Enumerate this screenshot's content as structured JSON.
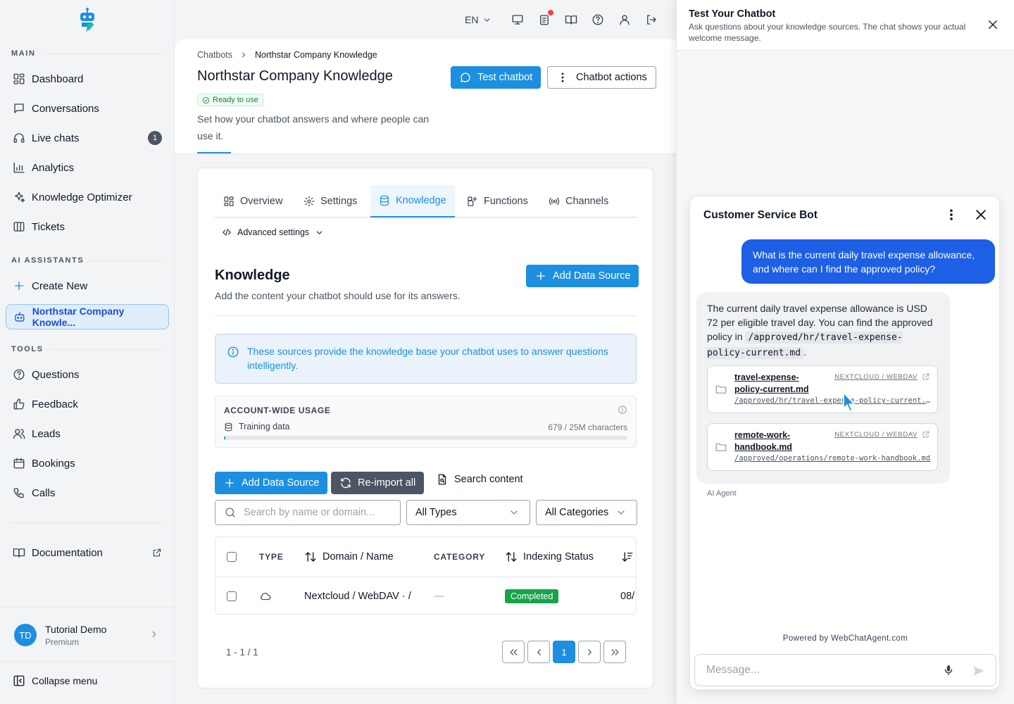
{
  "sidebar": {
    "sections": {
      "main": "MAIN",
      "ai_assistants": "AI ASSISTANTS",
      "tools": "TOOLS"
    },
    "main_items": [
      {
        "label": "Dashboard",
        "icon": "dashboard-icon"
      },
      {
        "label": "Conversations",
        "icon": "chat-icon"
      },
      {
        "label": "Live chats",
        "icon": "headset-icon",
        "badge": "1"
      },
      {
        "label": "Analytics",
        "icon": "bar-chart-icon"
      },
      {
        "label": "Knowledge Optimizer",
        "icon": "sparkle-icon"
      },
      {
        "label": "Tickets",
        "icon": "ticket-icon"
      }
    ],
    "assistant_items": [
      {
        "label": "Create New",
        "icon": "plus-icon"
      },
      {
        "label": "Northstar Company Knowle...",
        "icon": "bot-icon",
        "active": true
      }
    ],
    "tool_items": [
      {
        "label": "Questions",
        "icon": "question-icon"
      },
      {
        "label": "Feedback",
        "icon": "thumbs-up-icon"
      },
      {
        "label": "Leads",
        "icon": "users-icon"
      },
      {
        "label": "Bookings",
        "icon": "calendar-icon"
      },
      {
        "label": "Calls",
        "icon": "phone-icon"
      }
    ],
    "documentation": "Documentation",
    "user": {
      "initials": "TD",
      "name": "Tutorial Demo",
      "plan": "Premium"
    },
    "collapse_label": "Collapse menu"
  },
  "topbar": {
    "language": "EN"
  },
  "header": {
    "breadcrumb": [
      "Chatbots",
      "Northstar Company Knowledge"
    ],
    "title": "Northstar Company Knowledge",
    "status": "Ready to use",
    "description": "Set how your chatbot answers and where people can use it.",
    "test_button": "Test chatbot",
    "actions_button": "Chatbot actions"
  },
  "tabs": [
    {
      "label": "Overview",
      "icon": "grid-icon"
    },
    {
      "label": "Settings",
      "icon": "gear-icon"
    },
    {
      "label": "Knowledge",
      "icon": "database-icon",
      "active": true
    },
    {
      "label": "Functions",
      "icon": "functions-icon"
    },
    {
      "label": "Channels",
      "icon": "broadcast-icon"
    }
  ],
  "advanced_settings": "Advanced settings",
  "knowledge": {
    "title": "Knowledge",
    "description": "Add the content your chatbot should use for its answers.",
    "add_button": "Add Data Source",
    "info": "These sources provide the knowledge base your chatbot uses to answer questions intelligently.",
    "usage": {
      "label": "ACCOUNT-WIDE USAGE",
      "row_label": "Training data",
      "value_text": "679 / 25M characters",
      "fraction": 2.72e-05
    },
    "toolbar": {
      "add": "Add Data Source",
      "reimport": "Re-import all",
      "search_content": "Search content"
    },
    "filters": {
      "search_placeholder": "Search by name or domain...",
      "types": "All Types",
      "categories": "All Categories"
    },
    "table": {
      "headers": {
        "type": "TYPE",
        "domain": "Domain / Name",
        "category": "CATEGORY",
        "status": "Indexing Status"
      },
      "rows": [
        {
          "domain": "Nextcloud / WebDAV · /",
          "category": "—",
          "status": "Completed",
          "date": "08/"
        }
      ]
    },
    "pagination": {
      "range": "1 - 1 / 1",
      "current": "1"
    }
  },
  "test_panel": {
    "title": "Test Your Chatbot",
    "subtitle": "Ask questions about your knowledge sources. The chat shows your actual welcome message."
  },
  "chat": {
    "title": "Customer Service Bot",
    "user_message": "What is the current daily travel expense allowance, and where can I find the approved policy?",
    "bot_message_pre": "The current daily travel expense allowance is USD 72 per eligible travel day. You can find the approved policy in ",
    "bot_message_code": "/approved/hr/travel-expense-policy-current.md",
    "bot_message_post": ".",
    "sources": [
      {
        "name": "travel-expense-policy-current.md",
        "type": "NEXTCLOUD / WEBDAV",
        "path": "/approved/hr/travel-expense-policy-current.md"
      },
      {
        "name": "remote-work-handbook.md",
        "type": "NEXTCLOUD / WEBDAV",
        "path": "/approved/operations/remote-work-handbook.md"
      }
    ],
    "agent_label": "AI Agent",
    "powered_by": "Powered by WebChatAgent.com",
    "input_placeholder": "Message..."
  },
  "colors": {
    "accent": "#1d8fe1",
    "user_bubble": "#1d5fe5",
    "success": "#16a34a"
  }
}
